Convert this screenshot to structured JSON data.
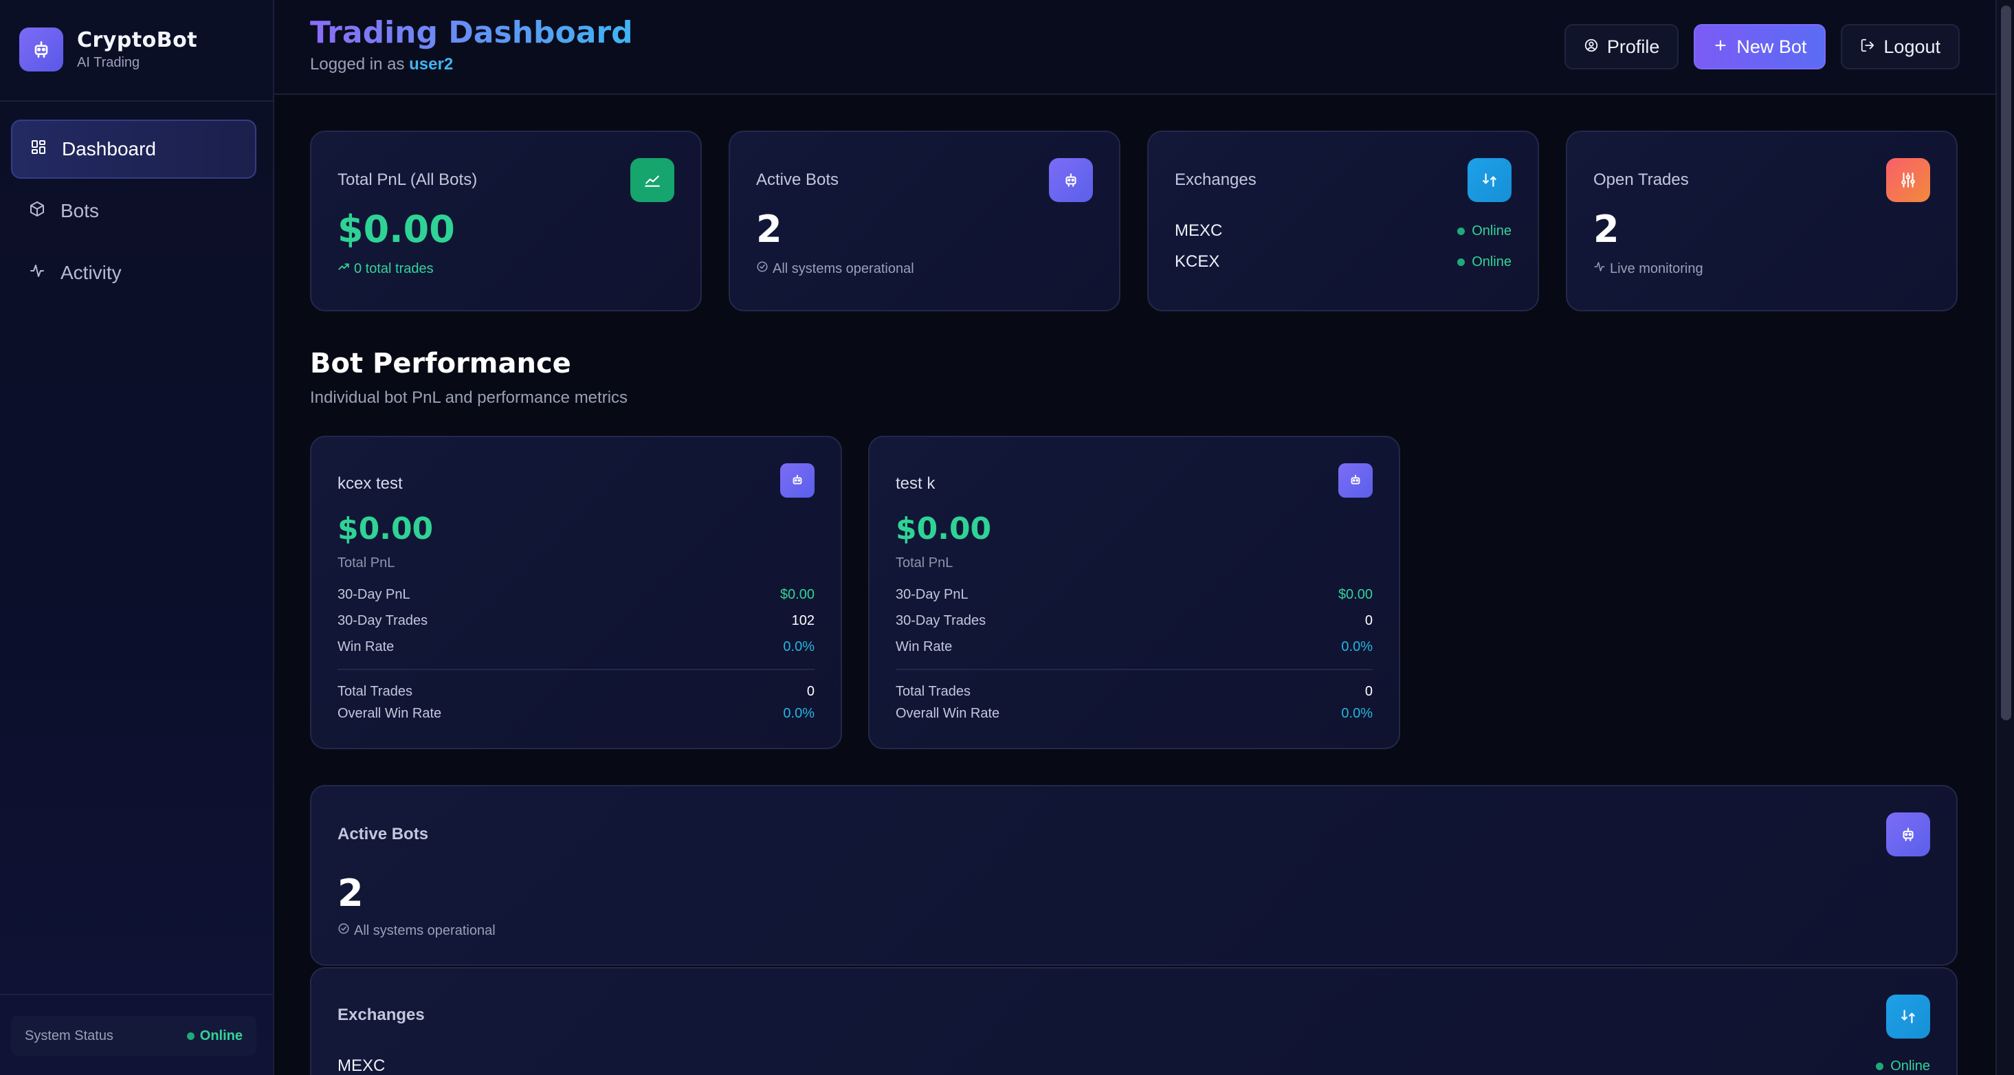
{
  "brand": {
    "name": "CryptoBot",
    "subtitle": "AI Trading",
    "logo_icon": "robot-icon"
  },
  "sidebar": {
    "items": [
      {
        "label": "Dashboard",
        "icon": "grid-icon",
        "active": true
      },
      {
        "label": "Bots",
        "icon": "box-icon",
        "active": false
      },
      {
        "label": "Activity",
        "icon": "pulse-icon",
        "active": false
      }
    ],
    "system_status": {
      "label": "System Status",
      "value": "Online"
    }
  },
  "header": {
    "title": "Trading Dashboard",
    "logged_prefix": "Logged in as",
    "username": "user2",
    "profile_label": "Profile",
    "new_bot_label": "New Bot",
    "logout_label": "Logout"
  },
  "stats": {
    "total_pnl": {
      "label": "Total PnL (All Bots)",
      "value": "$0.00",
      "note": "0 total trades",
      "icon": "trend-icon"
    },
    "active_bots": {
      "label": "Active Bots",
      "value": "2",
      "note": "All systems operational",
      "icon": "robot-icon"
    },
    "exchanges": {
      "label": "Exchanges",
      "icon": "swap-icon",
      "items": [
        {
          "name": "MEXC",
          "status": "Online"
        },
        {
          "name": "KCEX",
          "status": "Online"
        }
      ]
    },
    "open_trades": {
      "label": "Open Trades",
      "value": "2",
      "note": "Live monitoring",
      "icon": "sliders-icon"
    }
  },
  "bot_performance": {
    "title": "Bot Performance",
    "subtitle": "Individual bot PnL and performance metrics",
    "bots": [
      {
        "name": "kcex test",
        "pnl": "$0.00",
        "pnl_label": "Total PnL",
        "pnl_30d_label": "30-Day PnL",
        "pnl_30d": "$0.00",
        "trades_30d_label": "30-Day Trades",
        "trades_30d": "102",
        "win_rate_label": "Win Rate",
        "win_rate": "0.0%",
        "total_trades_label": "Total Trades",
        "total_trades": "0",
        "overall_win_label": "Overall Win Rate",
        "overall_win": "0.0%"
      },
      {
        "name": "test k",
        "pnl": "$0.00",
        "pnl_label": "Total PnL",
        "pnl_30d_label": "30-Day PnL",
        "pnl_30d": "$0.00",
        "trades_30d_label": "30-Day Trades",
        "trades_30d": "0",
        "win_rate_label": "Win Rate",
        "win_rate": "0.0%",
        "total_trades_label": "Total Trades",
        "total_trades": "0",
        "overall_win_label": "Overall Win Rate",
        "overall_win": "0.0%"
      }
    ]
  },
  "wide_active_bots": {
    "label": "Active Bots",
    "value": "2",
    "note": "All systems operational"
  },
  "wide_exchanges": {
    "label": "Exchanges",
    "first_name": "MEXC",
    "first_status": "Online"
  },
  "colors": {
    "accent": "#7b5cf5",
    "success": "#34d399",
    "info": "#27b5e0",
    "background": "#070914"
  }
}
